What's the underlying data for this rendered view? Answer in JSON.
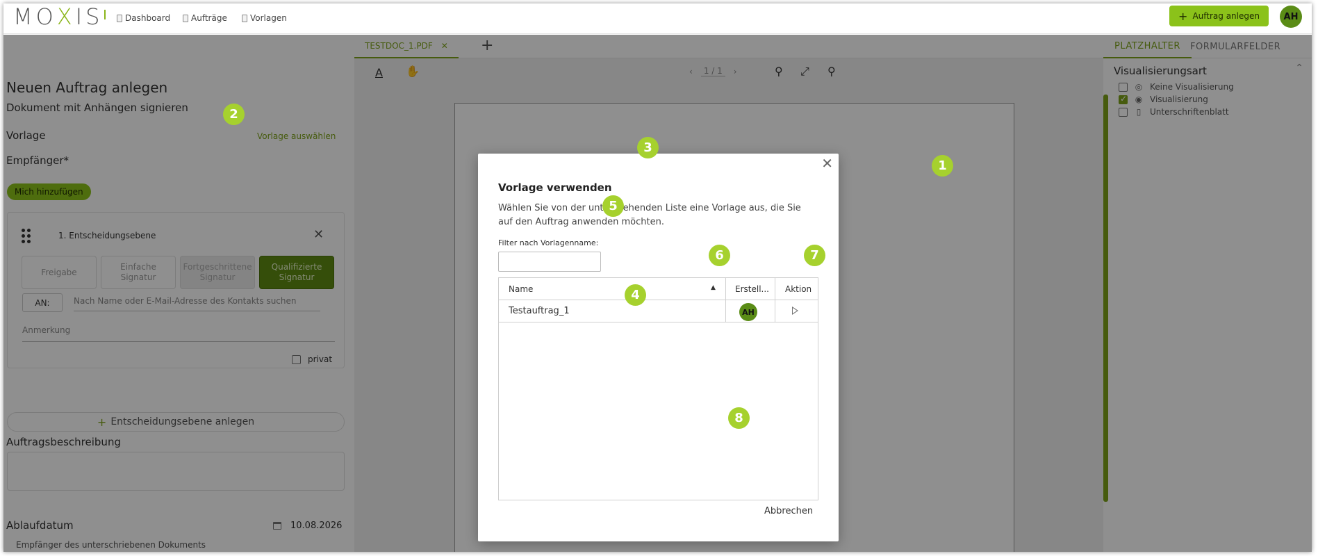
{
  "header": {
    "logo": {
      "part1": "MO",
      "x": "X",
      "part2": "IS"
    },
    "nav": [
      {
        "label": "Dashboard"
      },
      {
        "label": "Aufträge"
      },
      {
        "label": "Vorlagen"
      }
    ],
    "new_order_label": "Auftrag anlegen",
    "avatar_initials": "AH"
  },
  "left_panel": {
    "title": "Neuen Auftrag anlegen",
    "subtitle": "Dokument mit Anhängen signieren",
    "template_label": "Vorlage",
    "template_link": "Vorlage auswählen",
    "recipient_label": "Empfänger*",
    "add_me_label": "Mich hinzufügen",
    "decision_level": {
      "label": "1. Entscheidungsebene",
      "signature_types": [
        {
          "label": "Freigabe",
          "state": "normal"
        },
        {
          "label": "Einfache Signatur",
          "state": "normal"
        },
        {
          "label": "Fortgeschrittene Signatur",
          "state": "disabled"
        },
        {
          "label": "Qualifizierte Signatur",
          "state": "active"
        }
      ],
      "an_label": "AN:",
      "contact_placeholder": "Nach Name oder E-Mail-Adresse des Kontakts suchen",
      "note_placeholder": "Anmerkung",
      "private_label": "privat"
    },
    "add_level_label": "Entscheidungsebene anlegen",
    "description_label": "Auftragsbeschreibung",
    "expiry_label": "Ablaufdatum",
    "expiry_date": "10.08.2026",
    "cut_off_text": "Empfänger des unterschriebenen Dokuments"
  },
  "document": {
    "tab_label": "TESTDOC_1.PDF",
    "page_indicator": "1 / 1"
  },
  "right_panel": {
    "tabs": [
      {
        "label": "PLATZHALTER",
        "active": true
      },
      {
        "label": "FORMULARFELDER",
        "active": false
      }
    ],
    "section_title": "Visualisierungsart",
    "options": [
      {
        "label": "Keine Visualisierung",
        "checked": false,
        "icon": "eye-off-icon"
      },
      {
        "label": "Visualisierung",
        "checked": true,
        "icon": "eye-icon"
      },
      {
        "label": "Unterschriftenblatt",
        "checked": false,
        "icon": "document-icon"
      }
    ]
  },
  "modal": {
    "title": "Vorlage verwenden",
    "description": "Wählen Sie von der untenstehenden Liste eine Vorlage aus, die Sie auf den Auftrag anwenden möchten.",
    "filter_label": "Filter nach Vorlagenname:",
    "filter_value": "",
    "columns": [
      "Name",
      "Erstell...",
      "Aktion"
    ],
    "rows": [
      {
        "name": "Testauftrag_1",
        "creator_initials": "AH"
      }
    ],
    "cancel_label": "Abbrechen"
  },
  "badges": [
    "1",
    "2",
    "3",
    "4",
    "5",
    "6",
    "7",
    "8"
  ],
  "colors": {
    "accent": "#8bc21a",
    "accent_dark": "#5f8b12",
    "badge": "#a6d12e"
  }
}
